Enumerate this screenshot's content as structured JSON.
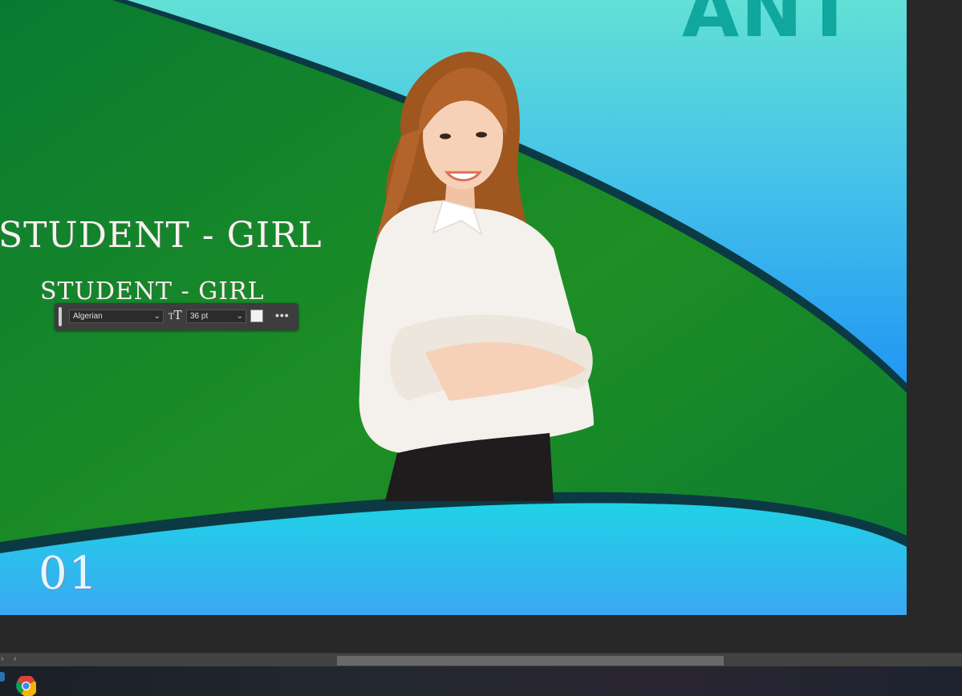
{
  "canvas": {
    "brand_text": "ANT",
    "headline_large": "STUDENT - GIRL",
    "headline_small": "STUDENT - GIRL",
    "slide_number": "01",
    "colors": {
      "green": "#1b8a2c",
      "teal_top": "#5ee0d6",
      "blue_right": "#2aa0f0",
      "cyan_bottom": "#22d0e8",
      "dark_stripe": "#0b3a40"
    }
  },
  "text_toolbar": {
    "font_family": "Algerian",
    "font_size": "36 pt",
    "font_size_icon": "font-size-icon",
    "color_swatch": "#f2f2f2",
    "more_label": "•••"
  },
  "scrollbar": {
    "left_arrow": "‹",
    "right_arrow": "›"
  },
  "taskbar": {
    "apps": [
      "chrome-icon"
    ]
  }
}
